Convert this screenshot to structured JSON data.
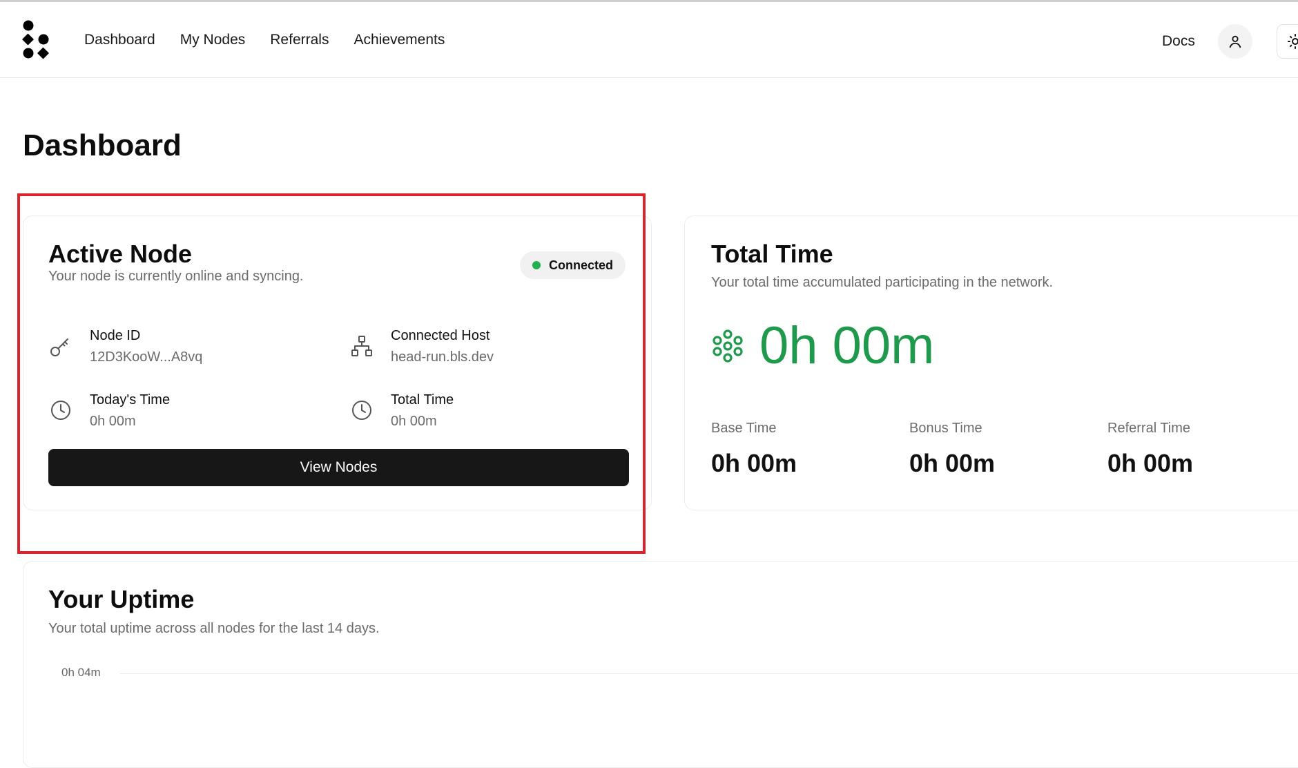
{
  "nav": {
    "items": [
      {
        "label": "Dashboard"
      },
      {
        "label": "My Nodes"
      },
      {
        "label": "Referrals"
      },
      {
        "label": "Achievements"
      }
    ],
    "docs_label": "Docs"
  },
  "page": {
    "title": "Dashboard"
  },
  "active_node": {
    "title": "Active Node",
    "subtitle": "Your node is currently online and syncing.",
    "status_label": "Connected",
    "status_color": "#22b14c",
    "node_id_label": "Node ID",
    "node_id_value": "12D3KooW...A8vq",
    "host_label": "Connected Host",
    "host_value": "head-run.bls.dev",
    "today_label": "Today's Time",
    "today_value": "0h 00m",
    "total_label": "Total Time",
    "total_value": "0h 00m",
    "button_label": "View Nodes",
    "icons": [
      "key-icon",
      "network-icon",
      "clock-icon",
      "clock-icon"
    ]
  },
  "total_time": {
    "title": "Total Time",
    "subtitle": "Your total time accumulated participating in the network.",
    "value": "0h 00m",
    "value_color": "#1f9a4c",
    "base_label": "Base Time",
    "base_value": "0h 00m",
    "bonus_label": "Bonus Time",
    "bonus_value": "0h 00m",
    "referral_label": "Referral Time",
    "referral_value": "0h 00m"
  },
  "uptime": {
    "title": "Your Uptime",
    "subtitle": "Your total uptime across all nodes for the last 14 days.",
    "y_tick_top": "0h 04m"
  },
  "colors": {
    "accent_green": "#1f9a4c",
    "button_dark": "#171717",
    "highlight_red": "#d9232d"
  }
}
